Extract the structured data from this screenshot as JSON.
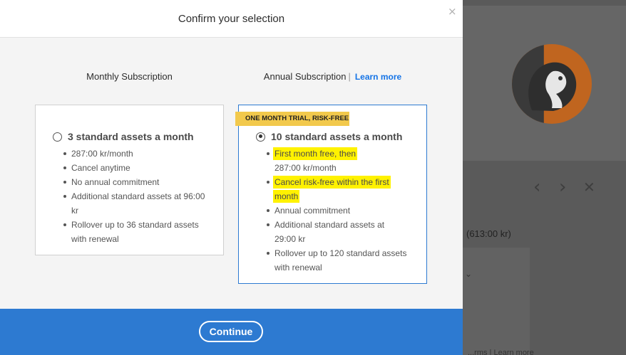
{
  "modal": {
    "title": "Confirm your selection",
    "close_icon": "×"
  },
  "columns": {
    "monthly_heading": "Monthly Subscription",
    "annual_heading": "Annual Subscription",
    "separator": "|",
    "learn_more": "Learn more"
  },
  "plans": {
    "monthly": {
      "name": "3 standard assets a month",
      "selected": false,
      "features": [
        "287:00 kr/month",
        "Cancel anytime",
        "No annual commitment",
        "Additional standard assets at 96:00 kr",
        "Rollover up to 36 standard assets with renewal"
      ]
    },
    "annual": {
      "badge": "ONE MONTH TRIAL, RISK-FREE",
      "name": "10 standard assets a month",
      "selected": true,
      "features": [
        {
          "lead": "First month free, then",
          "rest": "287:00 kr/month",
          "highlight": true
        },
        {
          "lead": "Cancel risk-free within the first",
          "rest": "month",
          "highlight": true
        },
        {
          "lead": "Annual commitment",
          "rest": "",
          "highlight": false
        },
        {
          "lead": "Additional standard assets at",
          "rest": "29:00 kr",
          "highlight": false
        },
        {
          "lead": "Rollover up to 120 standard assets",
          "rest": "with renewal",
          "highlight": false
        }
      ]
    }
  },
  "footer": {
    "continue_label": "Continue"
  },
  "background": {
    "nav_prev_icon": "‹",
    "nav_next_icon": "›",
    "nav_close_icon": "✕",
    "price_text": "(613:00 kr)",
    "chevron_icon": "⌄",
    "bottom_text": "...rms | Learn more"
  },
  "colors": {
    "accent": "#2d7ad1",
    "link": "#1473e6",
    "badge": "#f2c94c",
    "highlight": "#fff200"
  }
}
